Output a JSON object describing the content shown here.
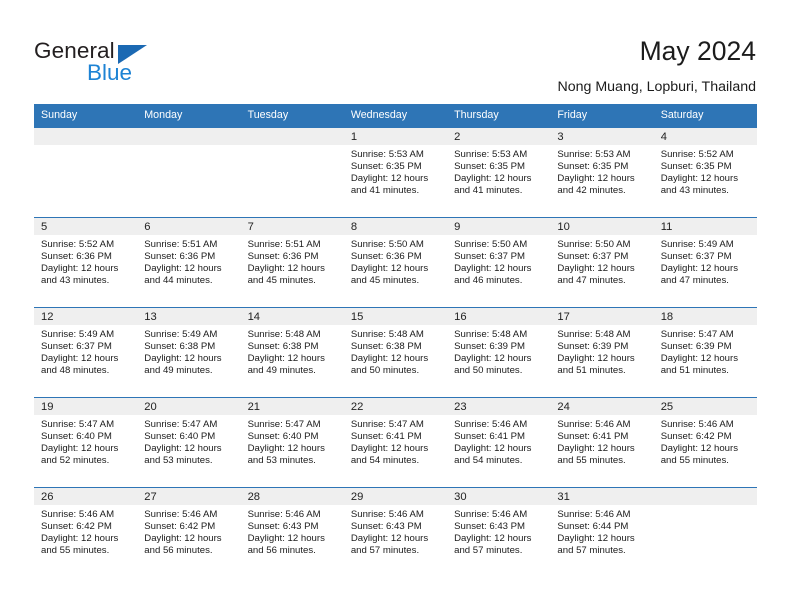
{
  "brand": {
    "name_top": "General",
    "name_bottom": "Blue",
    "triangle_color": "#1b69b3",
    "blue_text_color": "#1d83d4"
  },
  "header": {
    "title": "May 2024",
    "subtitle": "Nong Muang, Lopburi, Thailand"
  },
  "theme": {
    "header_blue": "#2e75b6",
    "day_band_gray": "#efefef",
    "cell_white": "#ffffff"
  },
  "weekdays": [
    "Sunday",
    "Monday",
    "Tuesday",
    "Wednesday",
    "Thursday",
    "Friday",
    "Saturday"
  ],
  "weeks": [
    [
      {
        "day": "",
        "sunrise": "",
        "sunset": "",
        "daylight1": "",
        "daylight2": ""
      },
      {
        "day": "",
        "sunrise": "",
        "sunset": "",
        "daylight1": "",
        "daylight2": ""
      },
      {
        "day": "",
        "sunrise": "",
        "sunset": "",
        "daylight1": "",
        "daylight2": ""
      },
      {
        "day": "1",
        "sunrise": "Sunrise: 5:53 AM",
        "sunset": "Sunset: 6:35 PM",
        "daylight1": "Daylight: 12 hours",
        "daylight2": "and 41 minutes."
      },
      {
        "day": "2",
        "sunrise": "Sunrise: 5:53 AM",
        "sunset": "Sunset: 6:35 PM",
        "daylight1": "Daylight: 12 hours",
        "daylight2": "and 41 minutes."
      },
      {
        "day": "3",
        "sunrise": "Sunrise: 5:53 AM",
        "sunset": "Sunset: 6:35 PM",
        "daylight1": "Daylight: 12 hours",
        "daylight2": "and 42 minutes."
      },
      {
        "day": "4",
        "sunrise": "Sunrise: 5:52 AM",
        "sunset": "Sunset: 6:35 PM",
        "daylight1": "Daylight: 12 hours",
        "daylight2": "and 43 minutes."
      }
    ],
    [
      {
        "day": "5",
        "sunrise": "Sunrise: 5:52 AM",
        "sunset": "Sunset: 6:36 PM",
        "daylight1": "Daylight: 12 hours",
        "daylight2": "and 43 minutes."
      },
      {
        "day": "6",
        "sunrise": "Sunrise: 5:51 AM",
        "sunset": "Sunset: 6:36 PM",
        "daylight1": "Daylight: 12 hours",
        "daylight2": "and 44 minutes."
      },
      {
        "day": "7",
        "sunrise": "Sunrise: 5:51 AM",
        "sunset": "Sunset: 6:36 PM",
        "daylight1": "Daylight: 12 hours",
        "daylight2": "and 45 minutes."
      },
      {
        "day": "8",
        "sunrise": "Sunrise: 5:50 AM",
        "sunset": "Sunset: 6:36 PM",
        "daylight1": "Daylight: 12 hours",
        "daylight2": "and 45 minutes."
      },
      {
        "day": "9",
        "sunrise": "Sunrise: 5:50 AM",
        "sunset": "Sunset: 6:37 PM",
        "daylight1": "Daylight: 12 hours",
        "daylight2": "and 46 minutes."
      },
      {
        "day": "10",
        "sunrise": "Sunrise: 5:50 AM",
        "sunset": "Sunset: 6:37 PM",
        "daylight1": "Daylight: 12 hours",
        "daylight2": "and 47 minutes."
      },
      {
        "day": "11",
        "sunrise": "Sunrise: 5:49 AM",
        "sunset": "Sunset: 6:37 PM",
        "daylight1": "Daylight: 12 hours",
        "daylight2": "and 47 minutes."
      }
    ],
    [
      {
        "day": "12",
        "sunrise": "Sunrise: 5:49 AM",
        "sunset": "Sunset: 6:37 PM",
        "daylight1": "Daylight: 12 hours",
        "daylight2": "and 48 minutes."
      },
      {
        "day": "13",
        "sunrise": "Sunrise: 5:49 AM",
        "sunset": "Sunset: 6:38 PM",
        "daylight1": "Daylight: 12 hours",
        "daylight2": "and 49 minutes."
      },
      {
        "day": "14",
        "sunrise": "Sunrise: 5:48 AM",
        "sunset": "Sunset: 6:38 PM",
        "daylight1": "Daylight: 12 hours",
        "daylight2": "and 49 minutes."
      },
      {
        "day": "15",
        "sunrise": "Sunrise: 5:48 AM",
        "sunset": "Sunset: 6:38 PM",
        "daylight1": "Daylight: 12 hours",
        "daylight2": "and 50 minutes."
      },
      {
        "day": "16",
        "sunrise": "Sunrise: 5:48 AM",
        "sunset": "Sunset: 6:39 PM",
        "daylight1": "Daylight: 12 hours",
        "daylight2": "and 50 minutes."
      },
      {
        "day": "17",
        "sunrise": "Sunrise: 5:48 AM",
        "sunset": "Sunset: 6:39 PM",
        "daylight1": "Daylight: 12 hours",
        "daylight2": "and 51 minutes."
      },
      {
        "day": "18",
        "sunrise": "Sunrise: 5:47 AM",
        "sunset": "Sunset: 6:39 PM",
        "daylight1": "Daylight: 12 hours",
        "daylight2": "and 51 minutes."
      }
    ],
    [
      {
        "day": "19",
        "sunrise": "Sunrise: 5:47 AM",
        "sunset": "Sunset: 6:40 PM",
        "daylight1": "Daylight: 12 hours",
        "daylight2": "and 52 minutes."
      },
      {
        "day": "20",
        "sunrise": "Sunrise: 5:47 AM",
        "sunset": "Sunset: 6:40 PM",
        "daylight1": "Daylight: 12 hours",
        "daylight2": "and 53 minutes."
      },
      {
        "day": "21",
        "sunrise": "Sunrise: 5:47 AM",
        "sunset": "Sunset: 6:40 PM",
        "daylight1": "Daylight: 12 hours",
        "daylight2": "and 53 minutes."
      },
      {
        "day": "22",
        "sunrise": "Sunrise: 5:47 AM",
        "sunset": "Sunset: 6:41 PM",
        "daylight1": "Daylight: 12 hours",
        "daylight2": "and 54 minutes."
      },
      {
        "day": "23",
        "sunrise": "Sunrise: 5:46 AM",
        "sunset": "Sunset: 6:41 PM",
        "daylight1": "Daylight: 12 hours",
        "daylight2": "and 54 minutes."
      },
      {
        "day": "24",
        "sunrise": "Sunrise: 5:46 AM",
        "sunset": "Sunset: 6:41 PM",
        "daylight1": "Daylight: 12 hours",
        "daylight2": "and 55 minutes."
      },
      {
        "day": "25",
        "sunrise": "Sunrise: 5:46 AM",
        "sunset": "Sunset: 6:42 PM",
        "daylight1": "Daylight: 12 hours",
        "daylight2": "and 55 minutes."
      }
    ],
    [
      {
        "day": "26",
        "sunrise": "Sunrise: 5:46 AM",
        "sunset": "Sunset: 6:42 PM",
        "daylight1": "Daylight: 12 hours",
        "daylight2": "and 55 minutes."
      },
      {
        "day": "27",
        "sunrise": "Sunrise: 5:46 AM",
        "sunset": "Sunset: 6:42 PM",
        "daylight1": "Daylight: 12 hours",
        "daylight2": "and 56 minutes."
      },
      {
        "day": "28",
        "sunrise": "Sunrise: 5:46 AM",
        "sunset": "Sunset: 6:43 PM",
        "daylight1": "Daylight: 12 hours",
        "daylight2": "and 56 minutes."
      },
      {
        "day": "29",
        "sunrise": "Sunrise: 5:46 AM",
        "sunset": "Sunset: 6:43 PM",
        "daylight1": "Daylight: 12 hours",
        "daylight2": "and 57 minutes."
      },
      {
        "day": "30",
        "sunrise": "Sunrise: 5:46 AM",
        "sunset": "Sunset: 6:43 PM",
        "daylight1": "Daylight: 12 hours",
        "daylight2": "and 57 minutes."
      },
      {
        "day": "31",
        "sunrise": "Sunrise: 5:46 AM",
        "sunset": "Sunset: 6:44 PM",
        "daylight1": "Daylight: 12 hours",
        "daylight2": "and 57 minutes."
      },
      {
        "day": "",
        "sunrise": "",
        "sunset": "",
        "daylight1": "",
        "daylight2": ""
      }
    ]
  ]
}
